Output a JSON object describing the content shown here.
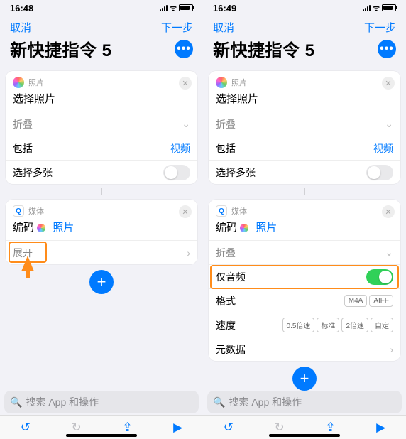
{
  "left": {
    "time": "16:48",
    "cancel": "取消",
    "next": "下一步",
    "title": "新快捷指令 5",
    "photos_app": "照片",
    "select_photo": "选择照片",
    "collapse": "折叠",
    "include": "包括",
    "include_val": "视频",
    "multi": "选择多张",
    "media_app": "媒体",
    "encode_prefix": "编码",
    "encode_link": "照片",
    "expand": "展开",
    "search_ph": "搜索 App 和操作"
  },
  "right": {
    "time": "16:49",
    "cancel": "取消",
    "next": "下一步",
    "title": "新快捷指令 5",
    "photos_app": "照片",
    "select_photo": "选择照片",
    "collapse": "折叠",
    "include": "包括",
    "include_val": "视频",
    "multi": "选择多张",
    "media_app": "媒体",
    "encode_prefix": "编码",
    "encode_link": "照片",
    "collapse2": "折叠",
    "audio_only": "仅音频",
    "format": "格式",
    "format_opts": [
      "M4A",
      "AIFF"
    ],
    "speed": "速度",
    "speed_opts": [
      "0.5倍速",
      "标准",
      "2倍速",
      "自定"
    ],
    "metadata": "元数据",
    "search_ph": "搜索 App 和操作"
  }
}
